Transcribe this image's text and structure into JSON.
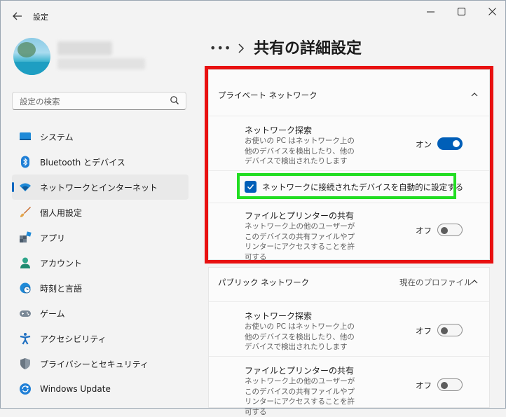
{
  "window": {
    "title": "設定"
  },
  "search": {
    "placeholder": "設定の検索"
  },
  "sidebar": {
    "items": [
      {
        "label": "システム"
      },
      {
        "label": "Bluetooth とデバイス"
      },
      {
        "label": "ネットワークとインターネット"
      },
      {
        "label": "個人用設定"
      },
      {
        "label": "アプリ"
      },
      {
        "label": "アカウント"
      },
      {
        "label": "時刻と言語"
      },
      {
        "label": "ゲーム"
      },
      {
        "label": "アクセシビリティ"
      },
      {
        "label": "プライバシーとセキュリティ"
      },
      {
        "label": "Windows Update"
      }
    ],
    "active_index": 2
  },
  "breadcrumb": {
    "ellipsis": "•••",
    "title": "共有の詳細設定"
  },
  "private": {
    "label": "プライベート ネットワーク",
    "discovery": {
      "title": "ネットワーク探索",
      "desc": "お使いの PC はネットワーク上の他のデバイスを検出したり、他のデバイスで検出されたりします",
      "state": "オン"
    },
    "auto_setup": {
      "label": "ネットワークに接続されたデバイスを自動的に設定する",
      "checked": true
    },
    "sharing": {
      "title": "ファイルとプリンターの共有",
      "desc": "ネットワーク上の他のユーザーがこのデバイスの共有ファイルやプリンターにアクセスすることを許可する",
      "state": "オフ"
    }
  },
  "public": {
    "label": "パブリック ネットワーク",
    "current_profile": "現在のプロファイル",
    "discovery": {
      "title": "ネットワーク探索",
      "desc": "お使いの PC はネットワーク上の他のデバイスを検出したり、他のデバイスで検出されたりします",
      "state": "オフ"
    },
    "sharing": {
      "title": "ファイルとプリンターの共有",
      "desc": "ネットワーク上の他のユーザーがこのデバイスの共有ファイルやプリンターにアクセスすることを許可する",
      "state": "オフ"
    }
  },
  "colors": {
    "accent": "#005fb8",
    "highlight_red": "#e81010",
    "highlight_green": "#22dd22"
  }
}
